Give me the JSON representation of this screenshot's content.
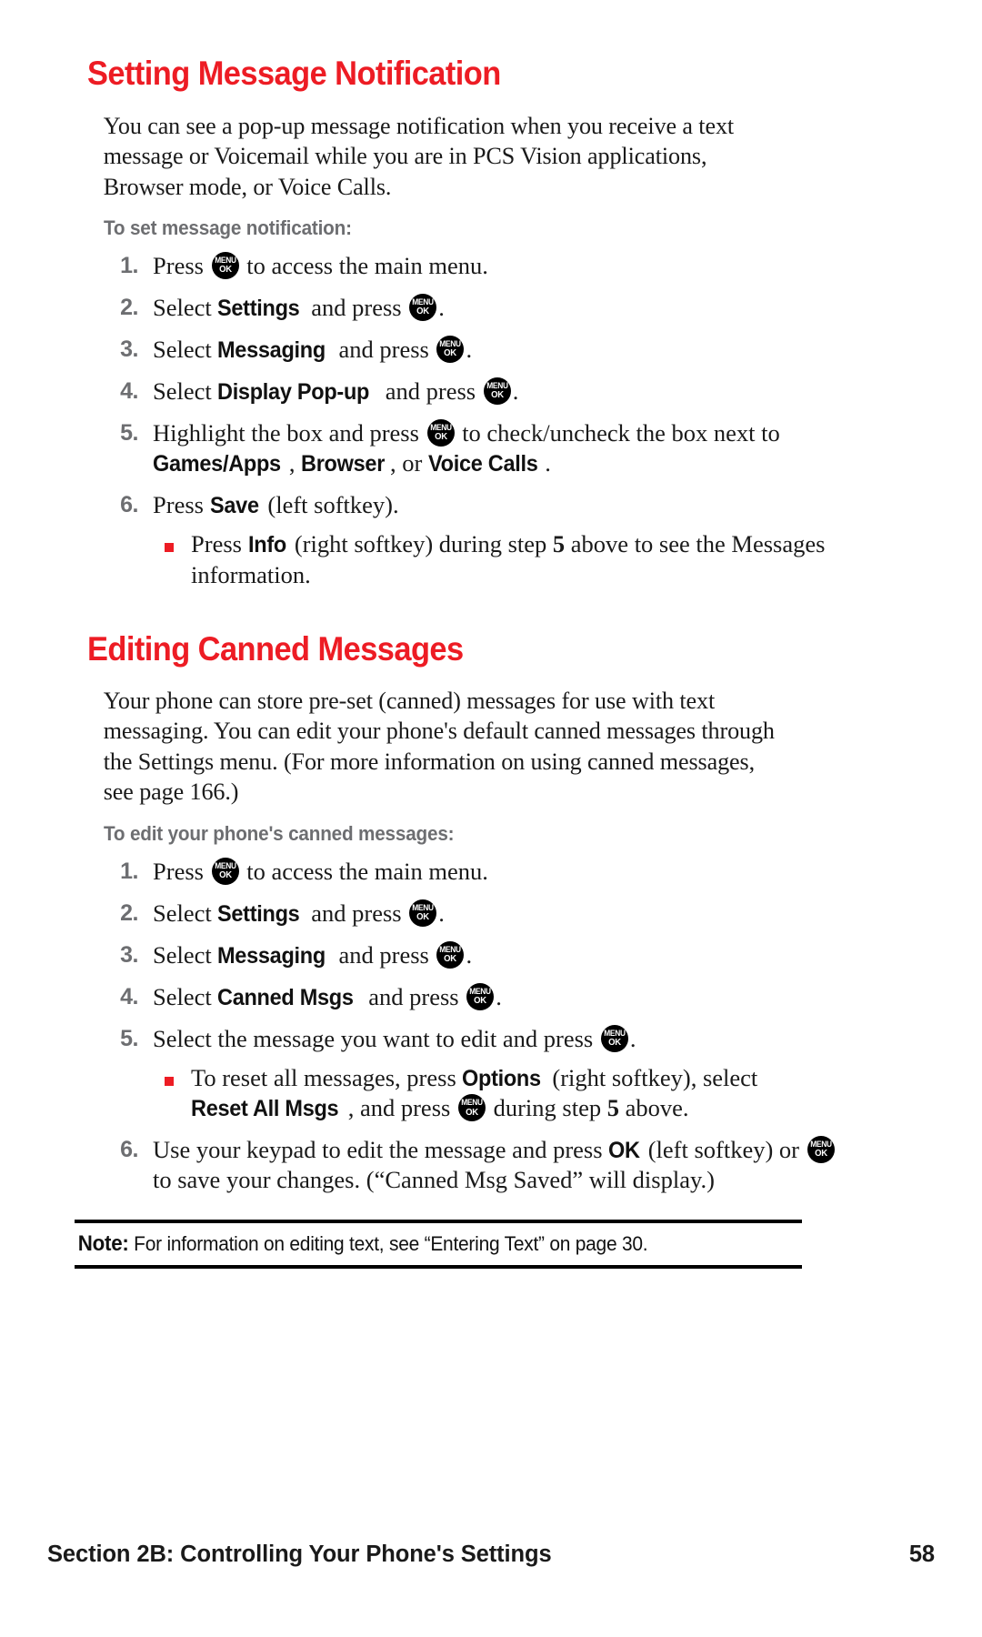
{
  "page": {
    "number": "58",
    "footer_section": "Section 2B: Controlling Your Phone's Settings"
  },
  "colors": {
    "heading_red": "#ed1c24",
    "subhead_gray": "#6d6e71",
    "bullet_red": "#ed1c24",
    "key_black": "#000000"
  },
  "key_icon": {
    "line1": "MENU",
    "line2": "OK"
  },
  "section1": {
    "heading": "Setting Message Notification",
    "intro": "You can see a pop-up message notification when you receive a text message or Voicemail while you are in PCS Vision applications, Browser mode, or Voice Calls.",
    "subhead": "To set message notification:",
    "steps": [
      {
        "num": "1.",
        "parts": [
          {
            "t": "text",
            "v": "Press "
          },
          {
            "t": "key"
          },
          {
            "t": "text",
            "v": " to access the main menu."
          }
        ]
      },
      {
        "num": "2.",
        "parts": [
          {
            "t": "text",
            "v": "Select "
          },
          {
            "t": "ui",
            "v": "Settings"
          },
          {
            "t": "text",
            "v": " and press "
          },
          {
            "t": "key"
          },
          {
            "t": "text",
            "v": "."
          }
        ]
      },
      {
        "num": "3.",
        "parts": [
          {
            "t": "text",
            "v": "Select "
          },
          {
            "t": "ui",
            "v": "Messaging"
          },
          {
            "t": "text",
            "v": " and press "
          },
          {
            "t": "key"
          },
          {
            "t": "text",
            "v": "."
          }
        ]
      },
      {
        "num": "4.",
        "parts": [
          {
            "t": "text",
            "v": "Select "
          },
          {
            "t": "ui",
            "v": "Display Pop-up"
          },
          {
            "t": "text",
            "v": " and press "
          },
          {
            "t": "key"
          },
          {
            "t": "text",
            "v": "."
          }
        ]
      },
      {
        "num": "5.",
        "parts": [
          {
            "t": "text",
            "v": "Highlight the box and press "
          },
          {
            "t": "key"
          },
          {
            "t": "text",
            "v": " to check/uncheck the box next to "
          },
          {
            "t": "ui",
            "v": "Games/Apps"
          },
          {
            "t": "text",
            "v": ", "
          },
          {
            "t": "ui",
            "v": "Browser"
          },
          {
            "t": "text",
            "v": ", or "
          },
          {
            "t": "ui",
            "v": "Voice Calls"
          },
          {
            "t": "text",
            "v": "."
          }
        ]
      },
      {
        "num": "6.",
        "parts": [
          {
            "t": "text",
            "v": "Press "
          },
          {
            "t": "ui",
            "v": "Save"
          },
          {
            "t": "text",
            "v": " (left softkey)."
          }
        ],
        "bullets": [
          {
            "parts": [
              {
                "t": "text",
                "v": "Press "
              },
              {
                "t": "ui",
                "v": "Info"
              },
              {
                "t": "text",
                "v": " (right softkey) during step "
              },
              {
                "t": "serifbold",
                "v": "5"
              },
              {
                "t": "text",
                "v": " above to see the Messages information."
              }
            ]
          }
        ]
      }
    ]
  },
  "section2": {
    "heading": "Editing Canned Messages",
    "intro": "Your phone can store pre-set (canned) messages for use with text messaging. You can edit your phone's default canned messages through the Settings menu. (For more information on using canned messages, see page 166.)",
    "subhead": "To edit your phone's canned messages:",
    "steps": [
      {
        "num": "1.",
        "parts": [
          {
            "t": "text",
            "v": "Press "
          },
          {
            "t": "key"
          },
          {
            "t": "text",
            "v": " to access the main menu."
          }
        ]
      },
      {
        "num": "2.",
        "parts": [
          {
            "t": "text",
            "v": "Select "
          },
          {
            "t": "ui",
            "v": "Settings"
          },
          {
            "t": "text",
            "v": " and press "
          },
          {
            "t": "key"
          },
          {
            "t": "text",
            "v": "."
          }
        ]
      },
      {
        "num": "3.",
        "parts": [
          {
            "t": "text",
            "v": "Select "
          },
          {
            "t": "ui",
            "v": "Messaging"
          },
          {
            "t": "text",
            "v": " and press "
          },
          {
            "t": "key"
          },
          {
            "t": "text",
            "v": "."
          }
        ]
      },
      {
        "num": "4.",
        "parts": [
          {
            "t": "text",
            "v": "Select "
          },
          {
            "t": "ui",
            "v": "Canned Msgs"
          },
          {
            "t": "text",
            "v": " and press "
          },
          {
            "t": "key"
          },
          {
            "t": "text",
            "v": "."
          }
        ]
      },
      {
        "num": "5.",
        "parts": [
          {
            "t": "text",
            "v": "Select the message you want to edit and press "
          },
          {
            "t": "key"
          },
          {
            "t": "text",
            "v": "."
          }
        ],
        "bullets": [
          {
            "parts": [
              {
                "t": "text",
                "v": "To reset all messages, press "
              },
              {
                "t": "ui",
                "v": "Options"
              },
              {
                "t": "text",
                "v": " (right softkey), select "
              },
              {
                "t": "ui",
                "v": "Reset All Msgs"
              },
              {
                "t": "text",
                "v": ", and press "
              },
              {
                "t": "key"
              },
              {
                "t": "text",
                "v": " during step "
              },
              {
                "t": "serifbold",
                "v": "5"
              },
              {
                "t": "text",
                "v": " above."
              }
            ]
          }
        ]
      },
      {
        "num": "6.",
        "parts": [
          {
            "t": "text",
            "v": "Use your keypad to edit the message and press "
          },
          {
            "t": "ui",
            "v": "OK"
          },
          {
            "t": "text",
            "v": " (left softkey) or "
          },
          {
            "t": "key"
          },
          {
            "t": "text",
            "v": " to save your changes. (“Canned Msg Saved” will display.)"
          }
        ]
      }
    ]
  },
  "note": {
    "label": "Note:",
    "text": "For information on editing text, see “Entering Text” on page 30."
  }
}
